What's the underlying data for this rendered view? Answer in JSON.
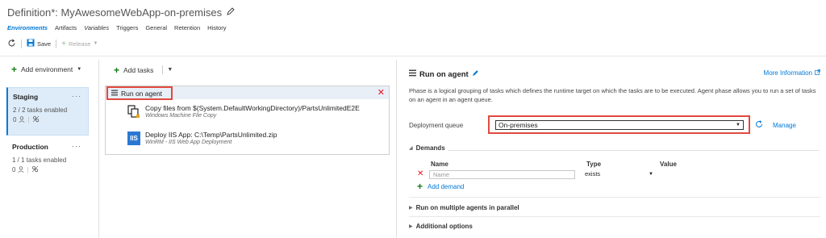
{
  "header": {
    "title": "Definition*: MyAwesomeWebApp-on-premises"
  },
  "tabs": [
    {
      "label": "Environments",
      "active": true
    },
    {
      "label": "Artifacts"
    },
    {
      "label": "Variables",
      "italic": true
    },
    {
      "label": "Triggers"
    },
    {
      "label": "General"
    },
    {
      "label": "Retention"
    },
    {
      "label": "History"
    }
  ],
  "toolbar": {
    "refresh_icon": "refresh-icon",
    "save_label": "Save",
    "release_label": "Release"
  },
  "left": {
    "add_environment_label": "Add environment",
    "environments": [
      {
        "name": "Staging",
        "status": "2 / 2 tasks enabled",
        "meta": "0",
        "menu": "···"
      },
      {
        "name": "Production",
        "status": "1 / 1 tasks enabled",
        "meta": "0",
        "menu": "···"
      }
    ]
  },
  "middle": {
    "add_tasks_label": "Add tasks",
    "phase_label": "Run on agent",
    "tasks": [
      {
        "name": "Copy files from $(System.DefaultWorkingDirectory)/PartsUnlimitedE2E",
        "subtitle": "Windows Machine File Copy",
        "icon": "file-copy-icon"
      },
      {
        "name": "Deploy IIS App: C:\\Temp\\PartsUnlimited.zip",
        "subtitle": "WinRM - IIS Web App Deployment",
        "icon": "iis-icon",
        "icon_text": "IIS"
      }
    ]
  },
  "detail": {
    "title": "Run on agent",
    "more_info_label": "More Information",
    "description": "Phase is a logical grouping of tasks which defines the runtime target on which the tasks are to be executed. Agent phase allows you to run a set of tasks on an agent in an agent queue.",
    "queue_label": "Deployment queue",
    "queue_value": "On-premises",
    "manage_label": "Manage",
    "demands": {
      "label": "Demands",
      "col_name": "Name",
      "col_type": "Type",
      "col_value": "Value",
      "row": {
        "name_placeholder": "Name",
        "type": "exists"
      },
      "add_label": "Add demand"
    },
    "sections": [
      {
        "label": "Run on multiple agents in parallel"
      },
      {
        "label": "Additional options"
      }
    ]
  },
  "colors": {
    "accent": "#0078d7",
    "highlight_border": "#e04a3f",
    "selected_bg": "#deecf9",
    "add_green": "#107c10",
    "delete_red": "#e81123"
  }
}
